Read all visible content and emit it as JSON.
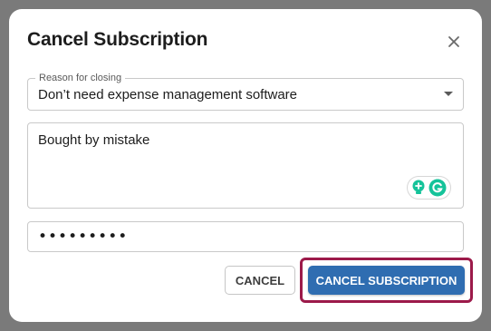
{
  "dialog": {
    "title": "Cancel Subscription",
    "close_icon": "close-icon"
  },
  "reason_select": {
    "label": "Reason for closing",
    "selected_value": "Don’t need expense management software",
    "caret_icon": "caret-down-icon"
  },
  "comment_textarea": {
    "value": "Bought by mistake",
    "grammarly_icons": [
      "grammarly-bulb-icon",
      "grammarly-logo-icon"
    ]
  },
  "password_field": {
    "masked_value": "•••••••••"
  },
  "actions": {
    "cancel_label": "CANCEL",
    "confirm_label": "CANCEL SUBSCRIPTION"
  },
  "colors": {
    "primary_button": "#2f6db1",
    "highlight_outline": "#9c1a4a",
    "grammarly_green": "#15c39a"
  }
}
